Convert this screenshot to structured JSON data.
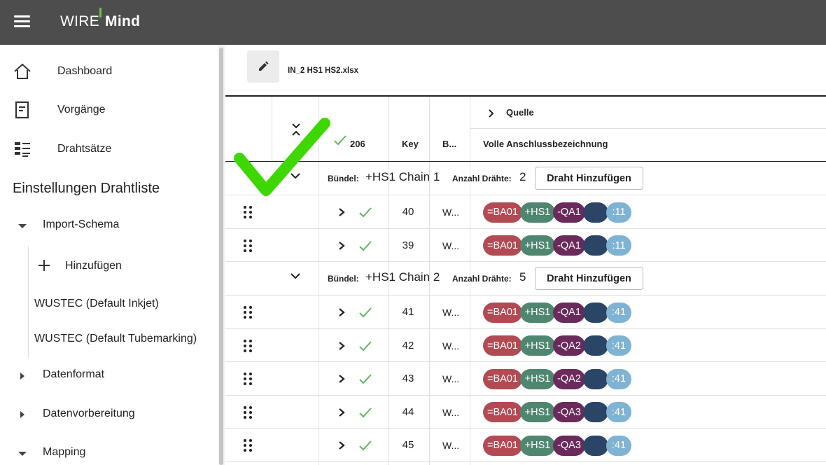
{
  "app": {
    "logo_wire": "WIRE",
    "logo_mind": "Mind"
  },
  "sidebar": {
    "nav": [
      {
        "label": "Dashboard",
        "icon": "home-icon"
      },
      {
        "label": "Vorgänge",
        "icon": "document-icon"
      },
      {
        "label": "Drahtsätze",
        "icon": "list-icon"
      }
    ],
    "section_title": "Einstellungen Drahtliste",
    "tree": {
      "import_schema": "Import-Schema",
      "add": "Hinzufügen",
      "schemas": [
        "WUSTEC (Default Inkjet)",
        "WUSTEC (Default Tubemarking)"
      ],
      "datenformat": "Datenformat",
      "datenvorbereitung": "Datenvorbereitung",
      "mapping": "Mapping"
    }
  },
  "main": {
    "file_name": "IN_2 HS1 HS2.xlsx",
    "header": {
      "check_count": "206",
      "key": "Key",
      "b": "B...",
      "quelle": "Quelle",
      "volle": "Volle Anschlussbezeichnung"
    },
    "bundle_label": "Bündel:",
    "count_label": "Anzahl Drähte:",
    "add_wire": "Draht Hinzufügen",
    "bundles": [
      {
        "name": "+HS1 Chain 1",
        "count": "2"
      },
      {
        "name": "+HS1 Chain 2",
        "count": "5"
      }
    ],
    "rows": [
      {
        "key": "40",
        "b": "W...",
        "chips": [
          "=BA01",
          "+HS1",
          "-QA1",
          "",
          ":11"
        ]
      },
      {
        "key": "39",
        "b": "W...",
        "chips": [
          "=BA01",
          "+HS1",
          "-QA1",
          "",
          ":11"
        ]
      },
      {
        "key": "41",
        "b": "W...",
        "chips": [
          "=BA01",
          "+HS1",
          "-QA1",
          "",
          ":41"
        ]
      },
      {
        "key": "42",
        "b": "W...",
        "chips": [
          "=BA01",
          "+HS1",
          "-QA2",
          "",
          ":41"
        ]
      },
      {
        "key": "43",
        "b": "W...",
        "chips": [
          "=BA01",
          "+HS1",
          "-QA2",
          "",
          ":41"
        ]
      },
      {
        "key": "44",
        "b": "W...",
        "chips": [
          "=BA01",
          "+HS1",
          "-QA3",
          "",
          ":41"
        ]
      },
      {
        "key": "45",
        "b": "W...",
        "chips": [
          "=BA01",
          "+HS1",
          "-QA3",
          "",
          ":41"
        ]
      }
    ]
  },
  "colors": {
    "topbar": "#4d4d4d",
    "accent_green": "#3fd700",
    "chip_red": "#b24a53",
    "chip_green": "#4f8670",
    "chip_purple": "#6a2a5b",
    "chip_navy": "#2a4566",
    "chip_blue": "#7fb3d3"
  }
}
